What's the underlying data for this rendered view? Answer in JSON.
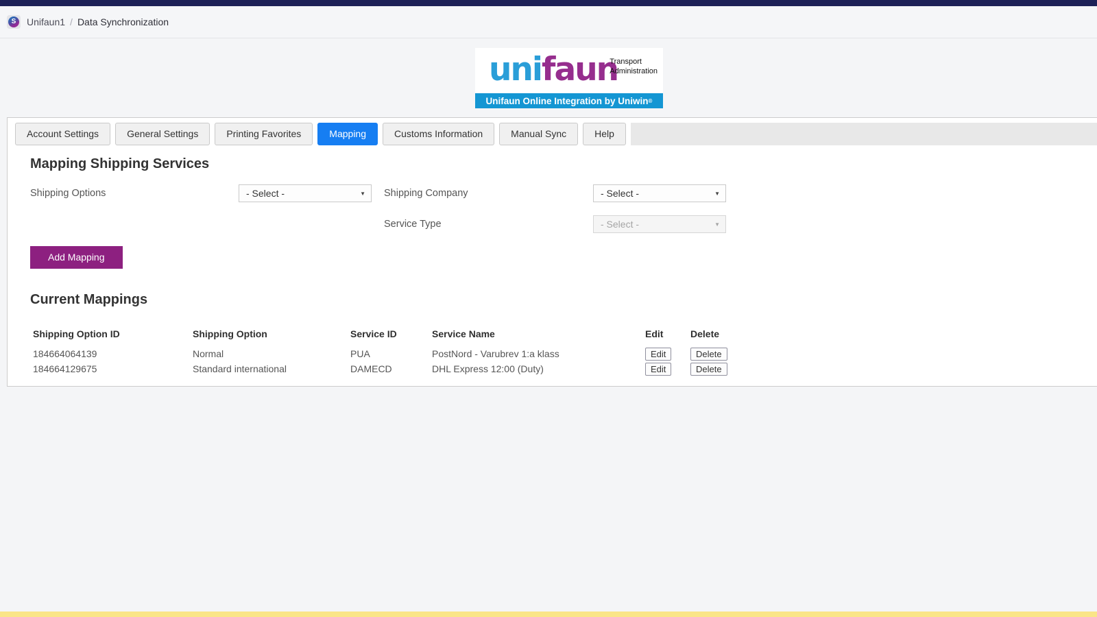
{
  "breadcrumb": {
    "app": "Unifaun1",
    "separator": "/",
    "page": "Data Synchronization"
  },
  "logo": {
    "brand_blue_part": "uni",
    "brand_purple_part": "faun",
    "tagline_line1": "Transport",
    "tagline_line2": "Administration",
    "banner_text": "Unifaun Online Integration by Uniwin",
    "banner_reg": "®"
  },
  "tabs": [
    {
      "label": "Account Settings",
      "active": false
    },
    {
      "label": "General Settings",
      "active": false
    },
    {
      "label": "Printing Favorites",
      "active": false
    },
    {
      "label": "Mapping",
      "active": true
    },
    {
      "label": "Customs Information",
      "active": false
    },
    {
      "label": "Manual Sync",
      "active": false
    },
    {
      "label": "Help",
      "active": false
    }
  ],
  "form": {
    "title": "Mapping Shipping Services",
    "fields": {
      "shipping_options": {
        "label": "Shipping Options",
        "value": "- Select -",
        "enabled": true
      },
      "shipping_company": {
        "label": "Shipping Company",
        "value": "- Select -",
        "enabled": true
      },
      "service_type": {
        "label": "Service Type",
        "value": "- Select -",
        "enabled": false
      }
    },
    "select_arrow": "▼",
    "add_button_label": "Add Mapping"
  },
  "mappings": {
    "title": "Current Mappings",
    "columns": [
      "Shipping Option ID",
      "Shipping Option",
      "Service ID",
      "Service Name",
      "Edit",
      "Delete"
    ],
    "rows": [
      {
        "shipping_option_id": "184664064139",
        "shipping_option": "Normal",
        "service_id": "PUA",
        "service_name": "PostNord - Varubrev 1:a klass",
        "edit_label": "Edit",
        "delete_label": "Delete"
      },
      {
        "shipping_option_id": "184664129675",
        "shipping_option": "Standard international",
        "service_id": "DAMECD",
        "service_name": "DHL Express 12:00 (Duty)",
        "edit_label": "Edit",
        "delete_label": "Delete"
      }
    ]
  },
  "colors": {
    "topbar_navy": "#1d2157",
    "page_background": "#f4f5f7",
    "active_tab_blue": "#167ef2",
    "brand_blue": "#2a9ed8",
    "brand_purple": "#962e8e",
    "banner_blue": "#1496d3",
    "add_button_purple": "#8d2080",
    "footer_yellow": "#fae588"
  }
}
